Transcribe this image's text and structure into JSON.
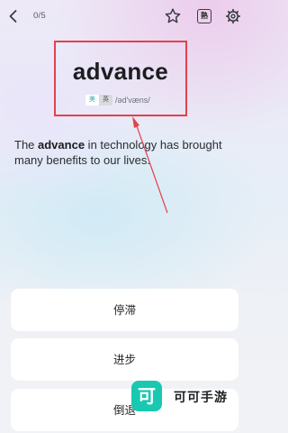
{
  "header": {
    "counter": "0/5",
    "familiar_label": "熟",
    "icons": {
      "back": "chevron-left-icon",
      "star": "star-outline-icon",
      "settings": "gear-icon"
    }
  },
  "card": {
    "word": "advance",
    "tag_us": "美",
    "tag_uk": "英",
    "phonetic": "/əd'væns/"
  },
  "sentence": {
    "before": "The ",
    "highlight": "advance",
    "after": " in technology has brought many benefits to our lives."
  },
  "options": [
    {
      "label": "停滞"
    },
    {
      "label": "进步"
    },
    {
      "label": "倒退"
    }
  ],
  "watermark": {
    "logo_char": "可",
    "text": "可可手游"
  },
  "colors": {
    "annotation_red": "#e3414b",
    "watermark_teal": "#19c8b0",
    "us_tag": "#2bb3a7"
  }
}
